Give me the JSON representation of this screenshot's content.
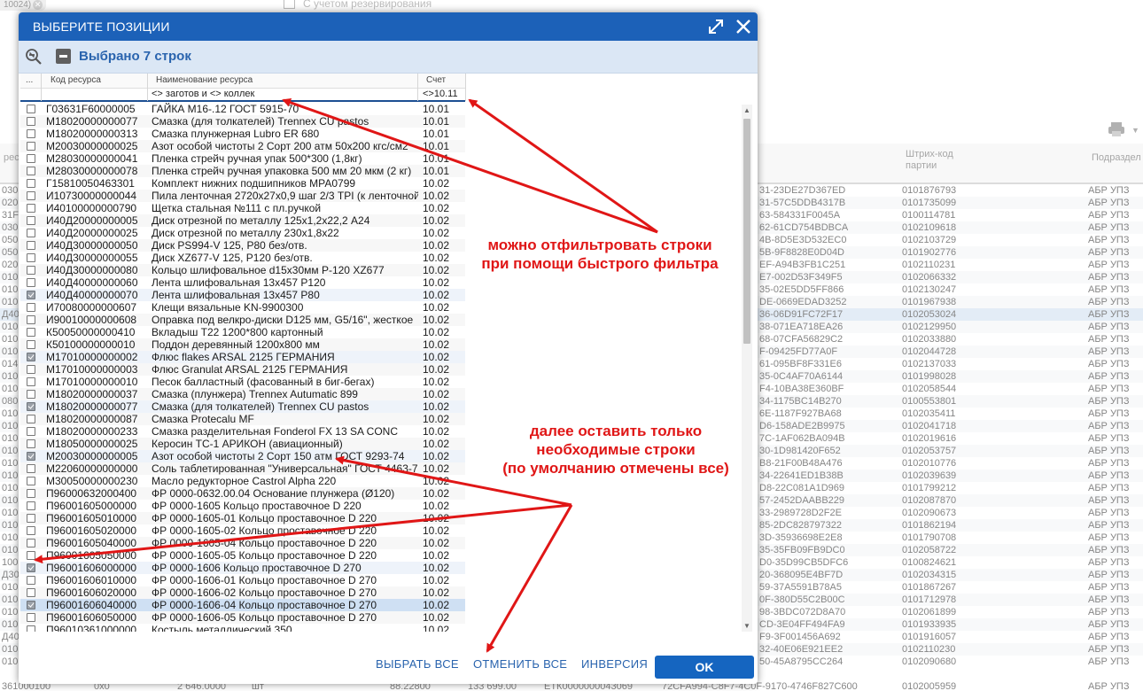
{
  "background": {
    "chip_text": "10024)",
    "checkbox_label": "С учетом резервирования",
    "headers": {
      "resource": "ресу",
      "barcode": "Штрих-код\nпартии",
      "division": "Подраздел"
    },
    "rows": [
      {
        "left": "030",
        "hash": "31-23DE27D367ED",
        "barcode": "0101876793",
        "div": "АБР УПЗ"
      },
      {
        "left": "020",
        "hash": "31-57C5DDB4317B",
        "barcode": "0101735099",
        "div": "АБР УПЗ"
      },
      {
        "left": "31F",
        "hash": "63-584331F0045A",
        "barcode": "0100114781",
        "div": "АБР УПЗ"
      },
      {
        "left": "030",
        "hash": "62-61CD754BDBCA",
        "barcode": "0102109618",
        "div": "АБР УПЗ"
      },
      {
        "left": "050",
        "hash": "4B-8D5E3D532EC0",
        "barcode": "0102103729",
        "div": "АБР УПЗ"
      },
      {
        "left": "050",
        "hash": "5B-9F8828E0D04D",
        "barcode": "0101902776",
        "div": "АБР УПЗ"
      },
      {
        "left": "020",
        "hash": "EF-A94B3FB1C251",
        "barcode": "0102110231",
        "div": "АБР УПЗ"
      },
      {
        "left": "010",
        "hash": "E7-002D53F349F5",
        "barcode": "0102066332",
        "div": "АБР УПЗ"
      },
      {
        "left": "010",
        "hash": "35-02E5DD5FF866",
        "barcode": "0102130247",
        "div": "АБР УПЗ"
      },
      {
        "left": "010",
        "hash": "DE-0669EDAD3252",
        "barcode": "0101967938",
        "div": "АБР УПЗ"
      },
      {
        "left": "Д40",
        "hash": "36-06D91FC72F17",
        "barcode": "0102053024",
        "div": "АБР УПЗ"
      },
      {
        "left": "010",
        "hash": "38-071EA718EA26",
        "barcode": "0102129950",
        "div": "АБР УПЗ"
      },
      {
        "left": "010",
        "hash": "68-07CFA56829C2",
        "barcode": "0102033880",
        "div": "АБР УПЗ"
      },
      {
        "left": "010",
        "hash": "F-09425FD77A0F",
        "barcode": "0102044728",
        "div": "АБР УПЗ"
      },
      {
        "left": "014",
        "hash": "61-095BF8F331E6",
        "barcode": "0102137033",
        "div": "АБР УПЗ"
      },
      {
        "left": "010",
        "hash": "35-0C4AF70A6144",
        "barcode": "0101998028",
        "div": "АБР УПЗ"
      },
      {
        "left": "010",
        "hash": "F4-10BA38E360BF",
        "barcode": "0102058544",
        "div": "АБР УПЗ"
      },
      {
        "left": "080",
        "hash": "34-1175BC14B270",
        "barcode": "0100553801",
        "div": "АБР УПЗ"
      },
      {
        "left": "010",
        "hash": "6E-1187F927BA68",
        "barcode": "0102035411",
        "div": "АБР УПЗ"
      },
      {
        "left": "010",
        "hash": "D6-158ADE2B9975",
        "barcode": "0102041718",
        "div": "АБР УПЗ"
      },
      {
        "left": "010",
        "hash": "7C-1AF062BA094B",
        "barcode": "0102019616",
        "div": "АБР УПЗ"
      },
      {
        "left": "010",
        "hash": "30-1D981420F652",
        "barcode": "0102053757",
        "div": "АБР УПЗ"
      },
      {
        "left": "010",
        "hash": "B8-21F00B48A476",
        "barcode": "0102010776",
        "div": "АБР УПЗ"
      },
      {
        "left": "010",
        "hash": "34-22641ED1B38B",
        "barcode": "0102039639",
        "div": "АБР УПЗ"
      },
      {
        "left": "010",
        "hash": "D8-22C081A1D969",
        "barcode": "0101799212",
        "div": "АБР УПЗ"
      },
      {
        "left": "010",
        "hash": "57-2452DAABB229",
        "barcode": "0102087870",
        "div": "АБР УПЗ"
      },
      {
        "left": "010",
        "hash": "33-2989728D2F2E",
        "barcode": "0102090673",
        "div": "АБР УПЗ"
      },
      {
        "left": "010",
        "hash": "85-2DC828797322",
        "barcode": "0101862194",
        "div": "АБР УПЗ"
      },
      {
        "left": "010",
        "hash": "3D-35936698E2E8",
        "barcode": "0101790708",
        "div": "АБР УПЗ"
      },
      {
        "left": "010",
        "hash": "35-35FB09FB9DC0",
        "barcode": "0102058722",
        "div": "АБР УПЗ"
      },
      {
        "left": "100",
        "hash": "D0-35D99CB5DFC6",
        "barcode": "0100824621",
        "div": "АБР УПЗ"
      },
      {
        "left": "Д30",
        "hash": "20-368095E4BF7D",
        "barcode": "0102034315",
        "div": "АБР УПЗ"
      },
      {
        "left": "010",
        "hash": "59-37A5591B78A5",
        "barcode": "0101867267",
        "div": "АБР УПЗ"
      },
      {
        "left": "010",
        "hash": "0F-380D55C2B00C",
        "barcode": "0101712978",
        "div": "АБР УПЗ"
      },
      {
        "left": "010",
        "hash": "98-3BDC072D8A70",
        "barcode": "0102061899",
        "div": "АБР УПЗ"
      },
      {
        "left": "010",
        "hash": "CD-3E04FF494FA9",
        "barcode": "0101933935",
        "div": "АБР УПЗ"
      },
      {
        "left": "Д40",
        "hash": "F9-3F001456A692",
        "barcode": "0101916057",
        "div": "АБР УПЗ"
      },
      {
        "left": "010",
        "hash": "32-40E06E921EE2",
        "barcode": "0102110230",
        "div": "АБР УПЗ"
      },
      {
        "left": "010",
        "hash": "50-45A8795CC264",
        "barcode": "0102090680",
        "div": "АБР УПЗ"
      }
    ],
    "footer_row": {
      "c0": "361000100",
      "c1": "0x0",
      "c2": "2 646.0000",
      "c3": "шт",
      "c4": "88.22800",
      "c5": "133 699.00",
      "c6": "ЕТК0000000043069",
      "c7": "72CFA994-C8F7-4C0F-9170-4746F827C600",
      "c8": "0102005959",
      "c9": "АБР УПЗ"
    }
  },
  "dialog": {
    "title": "ВЫБЕРИТЕ ПОЗИЦИИ",
    "selected_label": "Выбрано 7 строк",
    "columns": {
      "menu": "...",
      "code": "Код ресурса",
      "name": "Наименование ресурса",
      "account": "Счет"
    },
    "filters": {
      "name": "<> заготов и <> коллек",
      "account": "<>10.11"
    },
    "rows": [
      {
        "checked": false,
        "code": "Г03631F60000005",
        "name": "ГАЙКА М16-.12 ГОСТ 5915-70",
        "account": "10.01"
      },
      {
        "checked": false,
        "code": "М18020000000077",
        "name": "Смазка (для толкателей) Trennex CU pastos",
        "account": "10.01"
      },
      {
        "checked": false,
        "code": "М18020000000313",
        "name": "Смазка плунжерная Lubro ER 680",
        "account": "10.01"
      },
      {
        "checked": false,
        "code": "М20030000000025",
        "name": "Азот особой чистоты 2 Сорт 200 атм 50х200 кгс/см2",
        "account": "10.01"
      },
      {
        "checked": false,
        "code": "М28030000000041",
        "name": "Пленка стрейч ручная упак 500*300 (1,8кг)",
        "account": "10.01"
      },
      {
        "checked": false,
        "code": "М28030000000078",
        "name": "Пленка стрейч ручная упаковка 500 мм 20 мкм (2 кг)",
        "account": "10.01"
      },
      {
        "checked": false,
        "code": "Г15810050463301",
        "name": "Комплект нижних подшипников МРА0799",
        "account": "10.02"
      },
      {
        "checked": false,
        "code": "И10730000000044",
        "name": "Пила ленточная 2720х27х0,9 шаг 2/3 TPI (к ленточной",
        "account": "10.02"
      },
      {
        "checked": false,
        "code": "И40100000000790",
        "name": "Щетка стальная №111 с пл.ручкой",
        "account": "10.02"
      },
      {
        "checked": false,
        "code": "И40Д20000000005",
        "name": "Диск отрезной по металлу 125х1,2х22,2 А24",
        "account": "10.02"
      },
      {
        "checked": false,
        "code": "И40Д20000000025",
        "name": "Диск отрезной по металлу 230х1,8х22",
        "account": "10.02"
      },
      {
        "checked": false,
        "code": "И40Д30000000050",
        "name": "Диск PS994-V  125, P80 без/отв.",
        "account": "10.02"
      },
      {
        "checked": false,
        "code": "И40Д30000000055",
        "name": "Диск XZ677-V  125, P120 без/отв.",
        "account": "10.02"
      },
      {
        "checked": false,
        "code": "И40Д30000000080",
        "name": "Кольцо шлифовальное d15х30мм Р-120 XZ677",
        "account": "10.02"
      },
      {
        "checked": false,
        "code": "И40Д40000000060",
        "name": "Лента шлифовальная 13х457 Р120",
        "account": "10.02"
      },
      {
        "checked": true,
        "code": "И40Д40000000070",
        "name": "Лента шлифовальная 13х457 Р80",
        "account": "10.02"
      },
      {
        "checked": false,
        "code": "И70080000000607",
        "name": "Клещи вязальные KN-9900300",
        "account": "10.02"
      },
      {
        "checked": false,
        "code": "И90010000000608",
        "name": "Оправка под велкро-диски D125 мм, G5/16\", жесткое",
        "account": "10.02"
      },
      {
        "checked": false,
        "code": "К50050000000410",
        "name": "Вкладыш Т22 1200*800 картонный",
        "account": "10.02"
      },
      {
        "checked": false,
        "code": "К50100000000010",
        "name": "Поддон деревянный 1200х800 мм",
        "account": "10.02"
      },
      {
        "checked": true,
        "code": "М17010000000002",
        "name": "Флюс flakes ARSAL 2125 ГЕРМАНИЯ",
        "account": "10.02"
      },
      {
        "checked": false,
        "code": "М17010000000003",
        "name": "Флюс Granulat ARSAL 2125 ГЕРМАНИЯ",
        "account": "10.02"
      },
      {
        "checked": false,
        "code": "М17010000000010",
        "name": "Песок балластный (фасованный в биг-бегах)",
        "account": "10.02"
      },
      {
        "checked": false,
        "code": "М18020000000037",
        "name": "Смазка (плунжера) Trennex Autumatic 899",
        "account": "10.02"
      },
      {
        "checked": true,
        "code": "М18020000000077",
        "name": "Смазка (для толкателей) Trennex CU pastos",
        "account": "10.02"
      },
      {
        "checked": false,
        "code": "М18020000000087",
        "name": "Смазка Protecalu MF",
        "account": "10.02"
      },
      {
        "checked": false,
        "code": "М18020000000233",
        "name": "Смазка разделительная Fonderol FX 13 SA CONC",
        "account": "10.02"
      },
      {
        "checked": false,
        "code": "М18050000000025",
        "name": "Керосин ТС-1 АРИКОН (авиационный)",
        "account": "10.02"
      },
      {
        "checked": true,
        "code": "М20030000000005",
        "name": "Азот особой чистоты 2 Сорт 150 атм ГОСТ 9293-74",
        "account": "10.02"
      },
      {
        "checked": false,
        "code": "М22060000000000",
        "name": "Соль таблетированная \"Универсальная\" ГОСТ 4463-7",
        "account": "10.02"
      },
      {
        "checked": false,
        "code": "М30050000000230",
        "name": "Масло редукторное Castrol Alpha 220",
        "account": "10.02"
      },
      {
        "checked": false,
        "code": "П96000632000400",
        "name": "ФР 0000-0632.00.04 Основание плунжера (Ø120)",
        "account": "10.02"
      },
      {
        "checked": false,
        "code": "П96001605000000",
        "name": "ФР 0000-1605 Кольцо проставочное D 220",
        "account": "10.02"
      },
      {
        "checked": false,
        "code": "П96001605010000",
        "name": "ФР 0000-1605-01 Кольцо проставочное D 220",
        "account": "10.02"
      },
      {
        "checked": false,
        "code": "П96001605020000",
        "name": "ФР 0000-1605-02 Кольцо проставочное D 220",
        "account": "10.02"
      },
      {
        "checked": false,
        "code": "П96001605040000",
        "name": "ФР 0000-1605-04 Кольцо проставочное D 220",
        "account": "10.02"
      },
      {
        "checked": false,
        "code": "П96001605050000",
        "name": "ФР 0000-1605-05 Кольцо проставочное D 220",
        "account": "10.02"
      },
      {
        "checked": true,
        "code": "П96001606000000",
        "name": "ФР 0000-1606 Кольцо проставочное D 270",
        "account": "10.02"
      },
      {
        "checked": false,
        "code": "П96001606010000",
        "name": "ФР 0000-1606-01 Кольцо проставочное D 270",
        "account": "10.02"
      },
      {
        "checked": false,
        "code": "П96001606020000",
        "name": "ФР 0000-1606-02 Кольцо проставочное D 270",
        "account": "10.02"
      },
      {
        "checked": true,
        "code": "П96001606040000",
        "name": "ФР 0000-1606-04 Кольцо проставочное D 270",
        "account": "10.02",
        "highlight": true
      },
      {
        "checked": false,
        "code": "П96001606050000",
        "name": "ФР 0000-1606-05 Кольцо проставочное D 270",
        "account": "10.02"
      },
      {
        "checked": false,
        "code": "П96010361000000",
        "name": "Костыль металлический 350",
        "account": "10.02"
      }
    ],
    "footer": {
      "select_all": "ВЫБРАТЬ ВСЕ",
      "deselect_all": "ОТМЕНИТЬ ВСЕ",
      "invert": "ИНВЕРСИЯ",
      "ok": "OK"
    }
  },
  "annotations": {
    "filter_note_line1": "можно отфильтровать строки",
    "filter_note_line2": "при помощи быстрого фильтра",
    "select_note_line1": "далее оставить только",
    "select_note_line2": "необходимые строки",
    "select_note_line3": "(по умолчанию отмечены все)",
    "color": "#e01616"
  },
  "colors": {
    "title_bar": "#1c61b8",
    "toolbar": "#dbe7f5",
    "accent_text": "#2a64ae",
    "ok_button": "#1565c0"
  }
}
